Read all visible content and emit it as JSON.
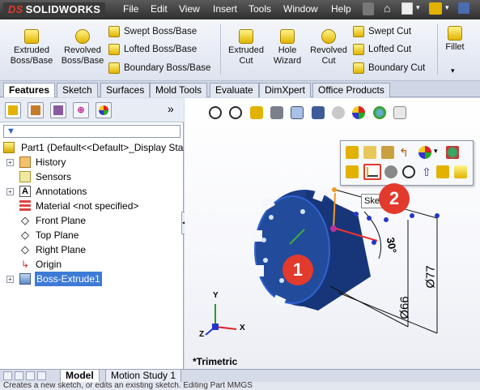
{
  "app": {
    "logo_mark": "DS",
    "logo_text": "SOLIDWORKS"
  },
  "menu": [
    "File",
    "Edit",
    "View",
    "Insert",
    "Tools",
    "Window",
    "Help"
  ],
  "ribbon": {
    "extruded_boss": "Extruded Boss/Base",
    "revolved_boss": "Revolved Boss/Base",
    "swept_boss": "Swept Boss/Base",
    "lofted_boss": "Lofted Boss/Base",
    "boundary_boss": "Boundary Boss/Base",
    "extruded_cut": "Extruded Cut",
    "hole_wizard": "Hole Wizard",
    "revolved_cut": "Revolved Cut",
    "swept_cut": "Swept Cut",
    "lofted_cut": "Lofted Cut",
    "boundary_cut": "Boundary Cut",
    "fillet": "Fillet"
  },
  "command_tabs": [
    "Features",
    "Sketch",
    "Surfaces",
    "Mold Tools",
    "Evaluate",
    "DimXpert",
    "Office Products"
  ],
  "panel": {
    "expand_glyph": "»"
  },
  "tree": {
    "root": "Part1  (Default<<Default>_Display Sta",
    "items": [
      "History",
      "Sensors",
      "Annotations",
      "Material <not specified>",
      "Front Plane",
      "Top Plane",
      "Right Plane",
      "Origin",
      "Boss-Extrude1"
    ]
  },
  "viewport": {
    "view_name": "*Trimetric",
    "tooltip": "Ske",
    "dim_30": "30°",
    "dim_77": "Ø77",
    "dim_66": "Ø66",
    "callout_1": "1",
    "callout_2": "2",
    "axis_x": "X",
    "axis_y": "Y",
    "axis_z": "Z"
  },
  "bottom_tabs": [
    "Model",
    "Motion Study 1"
  ],
  "status": "Creates a new sketch, or edits an existing sketch.        Editing Part        MMGS"
}
